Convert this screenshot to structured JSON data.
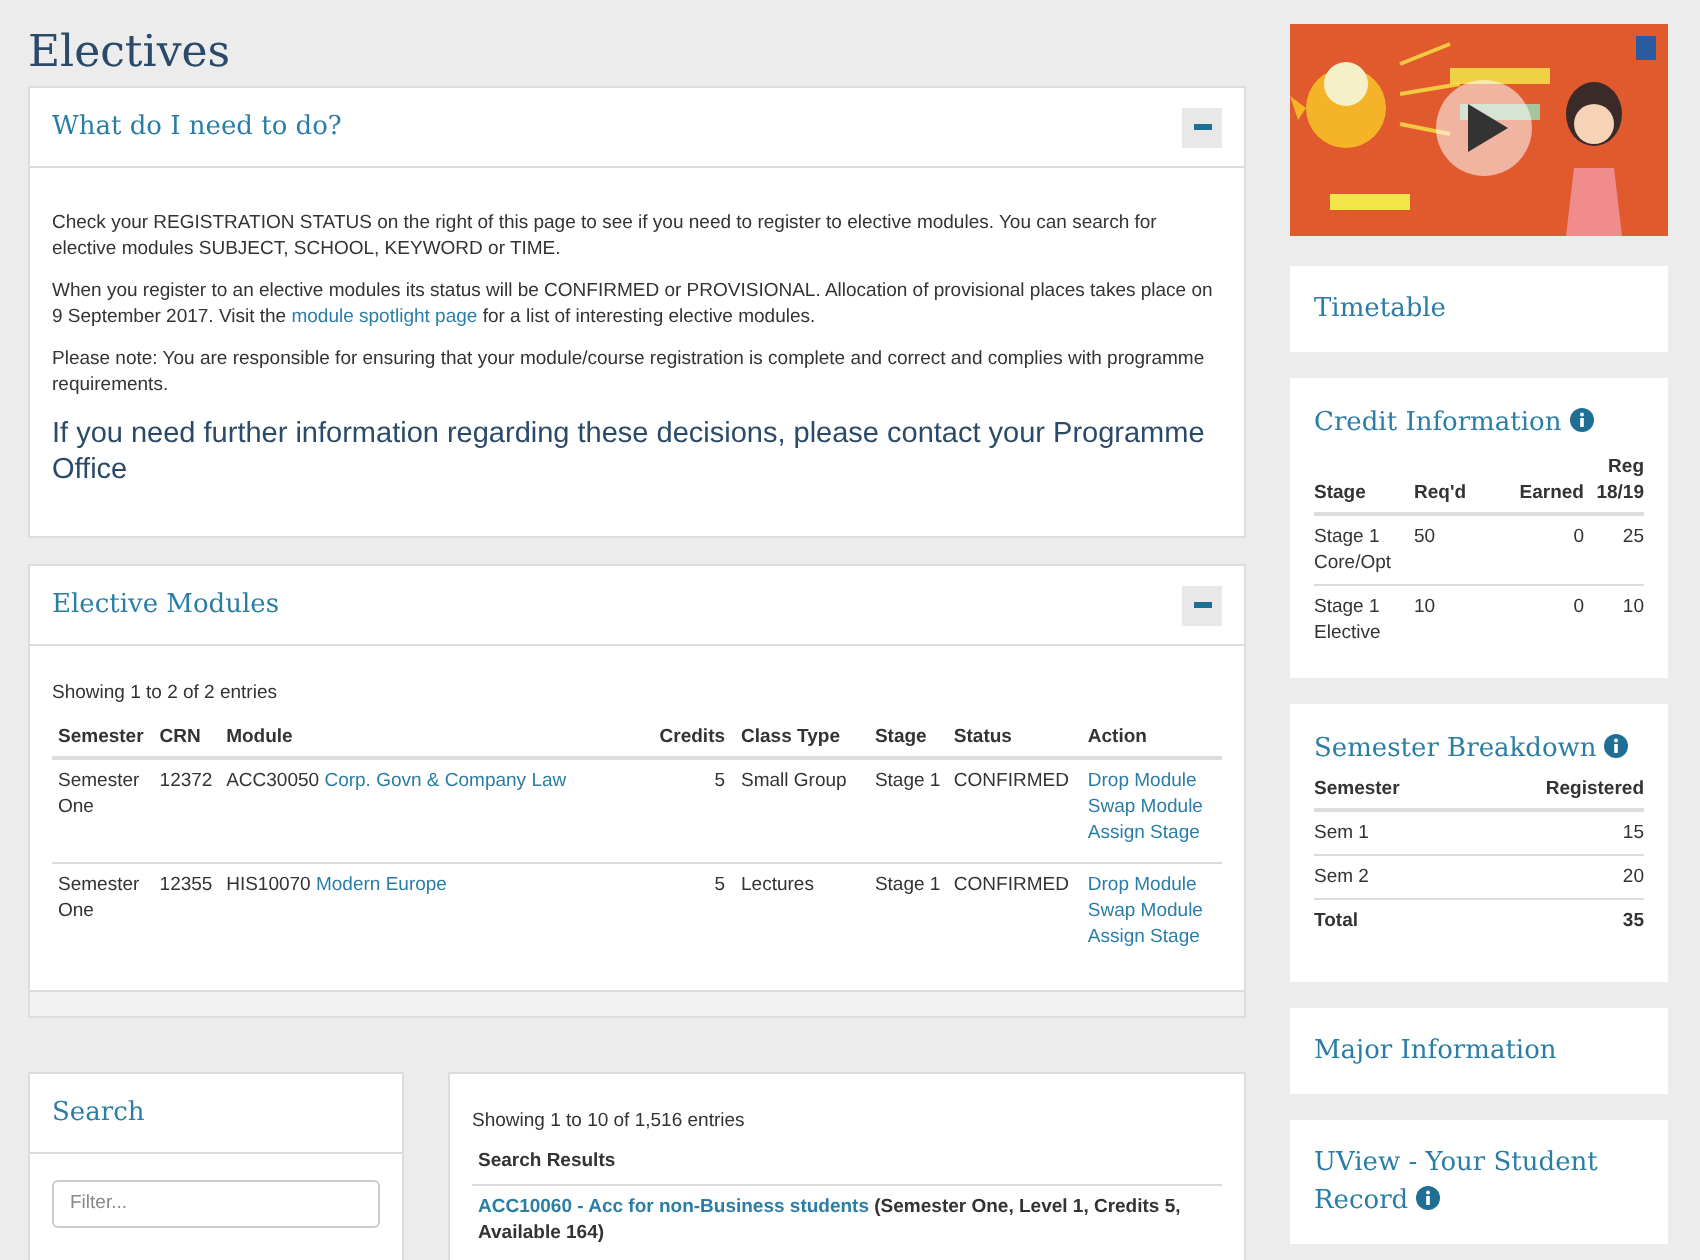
{
  "page_title": "Electives",
  "info_panel": {
    "title": "What do I need to do?",
    "paragraphs": [
      {
        "kind": "text",
        "text": "Check your REGISTRATION STATUS on the right of this page to see if you need to register to elective modules. You can search for elective modules SUBJECT, SCHOOL, KEYWORD or TIME."
      },
      {
        "kind": "link",
        "before": "When you register to an elective modules its status will be CONFIRMED or PROVISIONAL. Allocation of provisional places takes place on 9 September 2017. Visit the",
        "link": "module spotlight page",
        "after": "for a list of interesting elective modules."
      },
      {
        "kind": "text",
        "text": "Please note: You are responsible for ensuring that your module/course registration is complete and correct and complies with programme requirements."
      },
      {
        "kind": "lead",
        "text": "If you need further information regarding these decisions, please contact your Programme Office"
      }
    ]
  },
  "modules_panel": {
    "title": "Elective Modules",
    "summary": "Showing 1 to 2 of 2 entries",
    "columns": [
      "Semester",
      "CRN",
      "Module",
      "Credits",
      "Class Type",
      "Stage",
      "Status",
      "Action"
    ],
    "rows": [
      {
        "semester": "Semester One",
        "crn": "12372",
        "code": "ACC30050",
        "name": "Corp. Govn & Company Law",
        "credits": "5",
        "class_type": "Small Group",
        "stage": "Stage 1",
        "status": "CONFIRMED",
        "actions": [
          "Drop Module",
          "Swap Module",
          "Assign Stage"
        ]
      },
      {
        "semester": "Semester One",
        "crn": "12355",
        "code": "HIS10070",
        "name": "Modern Europe",
        "credits": "5",
        "class_type": "Lectures",
        "stage": "Stage 1",
        "status": "CONFIRMED",
        "actions": [
          "Drop Module",
          "Swap Module",
          "Assign Stage"
        ]
      }
    ]
  },
  "search_panel": {
    "title": "Search",
    "filter": {
      "placeholder": "Filter..."
    }
  },
  "results_panel": {
    "summary": "Showing 1 to 10 of 1,516 entries",
    "column": "Search Results",
    "results": [
      {
        "link": "ACC10060 - Acc for non-Business students",
        "details": "(Semester One, Level 1, Credits 5, Available 164)"
      }
    ]
  },
  "sidebar": {
    "timetable": {
      "title": "Timetable"
    },
    "credit_info": {
      "title": "Credit Information",
      "columns": [
        "Stage",
        "Req'd",
        "Earned",
        "Reg 18/19"
      ],
      "rows": [
        {
          "stage": "Stage 1 Core/Opt",
          "required": "50",
          "earned": "0",
          "registered": "25"
        },
        {
          "stage": "Stage 1 Elective",
          "required": "10",
          "earned": "0",
          "registered": "10"
        }
      ]
    },
    "semester_breakdown": {
      "title": "Semester Breakdown",
      "columns": [
        "Semester",
        "Registered"
      ],
      "rows": [
        {
          "kind": "row",
          "semester": "Sem 1",
          "registered": "15"
        },
        {
          "kind": "row",
          "semester": "Sem 2",
          "registered": "20"
        },
        {
          "kind": "total",
          "semester": "Total",
          "registered": "35"
        }
      ]
    },
    "major_info": {
      "title": "Major Information"
    },
    "uview": {
      "title": "UView - Your Student Record"
    }
  }
}
